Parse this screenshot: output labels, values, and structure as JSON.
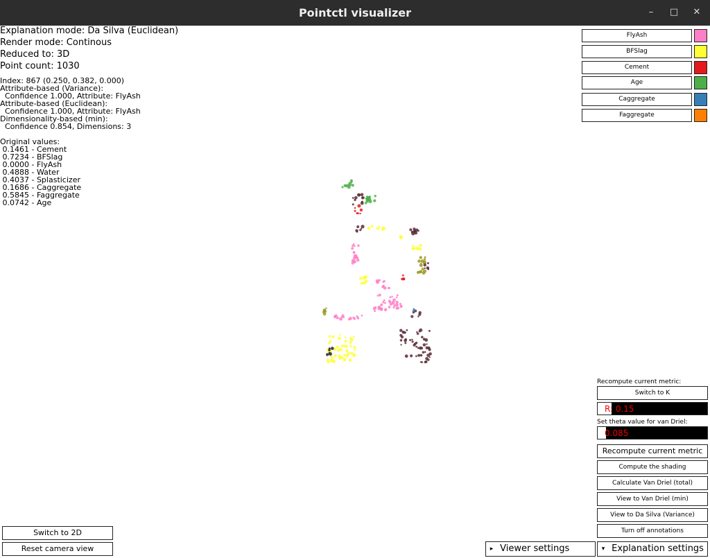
{
  "window": {
    "title": "Pointctl visualizer",
    "min_icon": "–",
    "max_icon": "□",
    "close_icon": "✕"
  },
  "status": {
    "explanation_mode": "Explanation mode: Da Silva (Euclidean)",
    "render_mode": "Render mode: Continous",
    "reduced_to": "Reduced to: 3D",
    "point_count": "Point count: 1030"
  },
  "selection": {
    "lines": [
      "Index: 867 (0.250, 0.382, 0.000)",
      "Attribute-based (Variance):",
      "  Confidence 1.000, Attribute: FlyAsh",
      "Attribute-based (Euclidean):",
      "  Confidence 1.000, Attribute: FlyAsh",
      "Dimensionality-based (min):",
      "  Confidence 0.854, Dimensions: 3"
    ]
  },
  "original_values": {
    "header": "Original values:",
    "rows": [
      " 0.1461 - Cement",
      " 0.7234 - BFSlag",
      " 0.0000 - FlyAsh",
      " 0.4888 - Water",
      " 0.4037 - Splasticizer",
      " 0.1686 - Caggregate",
      " 0.5845 - Faggregate",
      " 0.0742 - Age"
    ]
  },
  "legend": [
    {
      "label": "FlyAsh",
      "color": "#ff7fc6"
    },
    {
      "label": "BFSlag",
      "color": "#ffff33"
    },
    {
      "label": "Cement",
      "color": "#e41a1c"
    },
    {
      "label": "Age",
      "color": "#4daf4a"
    },
    {
      "label": "Caggregate",
      "color": "#377eb8"
    },
    {
      "label": "Faggregate",
      "color": "#ff7f00"
    }
  ],
  "panel": {
    "recompute_label": "Recompute current metric:",
    "switch_k": "Switch to K",
    "r_value": "R: 0.15",
    "theta_label": "Set theta value for van Driel:",
    "theta_value": "0.085",
    "recompute_button": "Recompute current metric",
    "compute_shading": "Compute the shading",
    "calc_van_driel": "Calculate Van Driel (total)",
    "view_van_driel": "View to Van Driel (min)",
    "view_da_silva": "View to Da Silva (Variance)",
    "turn_off_annotations": "Turn off annotations"
  },
  "bottom": {
    "switch_2d": "Switch to 2D",
    "reset_camera": "Reset camera view",
    "viewer_settings": "Viewer settings",
    "explanation_settings": "Explanation settings",
    "viewer_arrow": "▸",
    "explanation_arrow": "▾"
  }
}
